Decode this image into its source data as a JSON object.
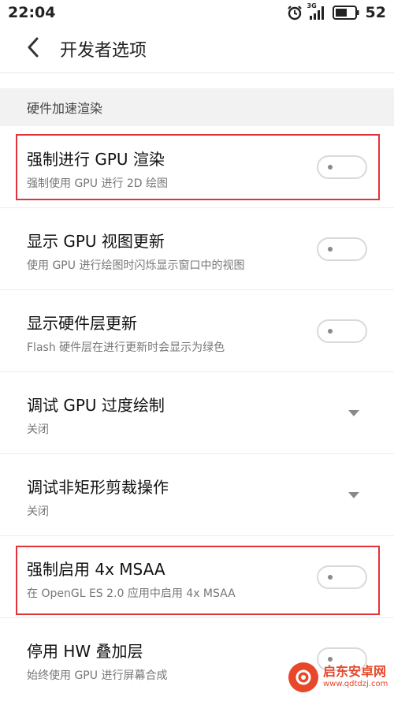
{
  "status_bar": {
    "time": "22:04",
    "network_label": "3G",
    "battery": "52",
    "icons": [
      "alarm-icon",
      "signal-icon",
      "battery-icon"
    ]
  },
  "header": {
    "title": "开发者选项",
    "back_icon": "chevron-left-icon"
  },
  "section": {
    "label": "硬件加速渲染"
  },
  "settings": [
    {
      "title": "强制进行 GPU 渲染",
      "subtitle": "强制使用 GPU 进行 2D 绘图",
      "control": "toggle",
      "checked": false
    },
    {
      "title": "显示 GPU 视图更新",
      "subtitle": "使用 GPU 进行绘图时闪烁显示窗口中的视图",
      "control": "toggle",
      "checked": false
    },
    {
      "title": "显示硬件层更新",
      "subtitle": "Flash 硬件层在进行更新时会显示为绿色",
      "control": "toggle",
      "checked": false
    },
    {
      "title": "调试 GPU 过度绘制",
      "subtitle": "关闭",
      "control": "dropdown"
    },
    {
      "title": "调试非矩形剪裁操作",
      "subtitle": "关闭",
      "control": "dropdown"
    },
    {
      "title": "强制启用 4x MSAA",
      "subtitle": "在 OpenGL ES 2.0 应用中启用 4x MSAA",
      "control": "toggle",
      "checked": false
    },
    {
      "title": "停用 HW 叠加层",
      "subtitle": "始终使用 GPU 进行屏幕合成",
      "control": "toggle",
      "checked": false
    }
  ],
  "watermark": {
    "name": "启东安卓网",
    "url": "www.qdtdzj.com"
  },
  "colors": {
    "highlight": "#e0343a",
    "section_bg": "#f2f2f2",
    "toggle_border": "#d9d9d9"
  }
}
